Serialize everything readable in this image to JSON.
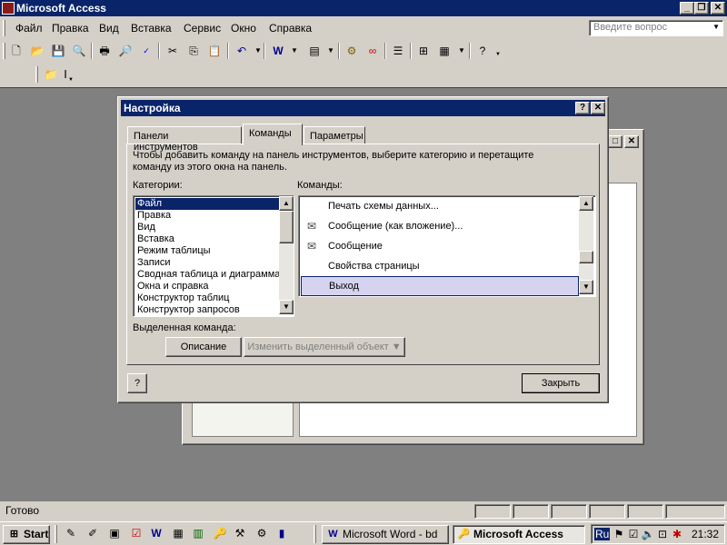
{
  "app": {
    "title": "Microsoft Access"
  },
  "menu": {
    "items": [
      "Файл",
      "Правка",
      "Вид",
      "Вставка",
      "Сервис",
      "Окно",
      "Справка"
    ],
    "question_placeholder": "Введите вопрос"
  },
  "toolbar": {
    "icons": [
      "new-icon",
      "open-icon",
      "save-icon",
      "search-file-icon",
      "print-icon",
      "print-preview-icon",
      "spelling-icon",
      "cut-icon",
      "copy-icon",
      "paste-icon",
      "undo-icon",
      "office-links-icon",
      "analyze-icon",
      "code-icon",
      "relationships-icon",
      "properties-icon",
      "tables-icon",
      "new-object-icon",
      "help-icon"
    ]
  },
  "dialog": {
    "title": "Настройка",
    "help_btn": "?",
    "close_btn": "✕",
    "tabs": [
      "Панели инструментов",
      "Команды",
      "Параметры"
    ],
    "active_tab": "Команды",
    "instruction_line1": "Чтобы добавить команду на панель инструментов, выберите категорию и перетащите",
    "instruction_line2": "команду из этого окна на панель.",
    "categories_label": "Категории:",
    "commands_label": "Команды:",
    "categories": [
      "Файл",
      "Правка",
      "Вид",
      "Вставка",
      "Режим таблицы",
      "Записи",
      "Сводная таблица и диаграмма",
      "Окна и справка",
      "Конструктор таблиц",
      "Конструктор запросов"
    ],
    "selected_category": "Файл",
    "commands": [
      {
        "label": "Печать схемы данных...",
        "icon": ""
      },
      {
        "label": "Сообщение (как вложение)...",
        "icon": "envelope-attach-icon"
      },
      {
        "label": "Сообщение",
        "icon": "envelope-icon"
      },
      {
        "label": "Свойства страницы",
        "icon": ""
      },
      {
        "label": "Выход",
        "icon": ""
      }
    ],
    "selected_command": "Выход",
    "selected_label": "Выделенная команда:",
    "description_btn": "Описание",
    "modify_btn": "Изменить выделенный объект ▼",
    "close_button": "Закрыть"
  },
  "statusbar": {
    "text": "Готово"
  },
  "taskbar": {
    "start": "Start",
    "tasks": [
      {
        "label": "Microsoft Word - bd",
        "active": false
      },
      {
        "label": "Microsoft Access",
        "active": true
      }
    ],
    "lang": "Ru",
    "time": "21:32"
  },
  "colors": {
    "titlebar": "#0a246a",
    "face": "#d4d0c8",
    "selection": "#0a246a",
    "cmd_selection": "#d6d3f0"
  }
}
